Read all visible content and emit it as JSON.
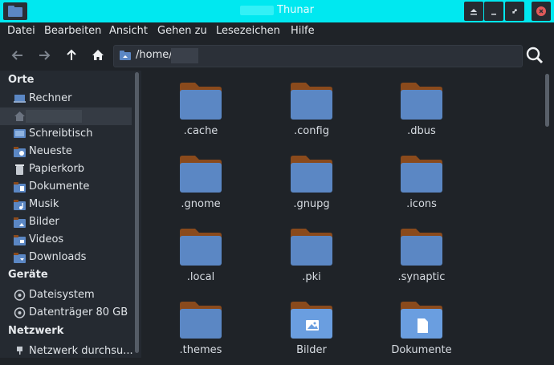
{
  "window": {
    "title": "Thunar",
    "colors": {
      "titlebar": "#00e8f0",
      "folder_body": "#5b87c4",
      "folder_tab": "#8a4a1c",
      "close_icon": "#e05a5a"
    }
  },
  "menubar": {
    "items": [
      "Datei",
      "Bearbeiten",
      "Ansicht",
      "Gehen zu",
      "Lesezeichen",
      "Hilfe"
    ]
  },
  "toolbar": {
    "back_icon": "arrow-left-icon",
    "forward_icon": "arrow-right-icon",
    "up_icon": "arrow-up-icon",
    "home_icon": "home-icon",
    "path": "/home/",
    "search_icon": "search-icon"
  },
  "sidebar": {
    "sections": [
      {
        "heading": "Orte",
        "items": [
          {
            "label": "Rechner",
            "icon": "computer-icon"
          },
          {
            "label": "",
            "icon": "home-icon",
            "selected": true
          },
          {
            "label": "Schreibtisch",
            "icon": "desktop-icon"
          },
          {
            "label": "Neueste",
            "icon": "recent-folder-icon"
          },
          {
            "label": "Papierkorb",
            "icon": "trash-icon"
          },
          {
            "label": "Dokumente",
            "icon": "documents-folder-icon"
          },
          {
            "label": "Musik",
            "icon": "music-folder-icon"
          },
          {
            "label": "Bilder",
            "icon": "pictures-folder-icon"
          },
          {
            "label": "Videos",
            "icon": "videos-folder-icon"
          },
          {
            "label": "Downloads",
            "icon": "downloads-folder-icon"
          }
        ]
      },
      {
        "heading": "Geräte",
        "items": [
          {
            "label": "Dateisystem",
            "icon": "drive-icon"
          },
          {
            "label": "Datenträger 80 GB",
            "icon": "drive-icon"
          }
        ]
      },
      {
        "heading": "Netzwerk",
        "items": [
          {
            "label": "Netzwerk durchsu...",
            "icon": "network-icon"
          }
        ]
      }
    ]
  },
  "files": [
    {
      "name": ".cache",
      "type": "folder"
    },
    {
      "name": ".config",
      "type": "folder"
    },
    {
      "name": ".dbus",
      "type": "folder"
    },
    {
      "name": ".gnome",
      "type": "folder"
    },
    {
      "name": ".gnupg",
      "type": "folder"
    },
    {
      "name": ".icons",
      "type": "folder"
    },
    {
      "name": ".local",
      "type": "folder"
    },
    {
      "name": ".pki",
      "type": "folder"
    },
    {
      "name": ".synaptic",
      "type": "folder"
    },
    {
      "name": ".themes",
      "type": "folder"
    },
    {
      "name": "Bilder",
      "type": "pictures-folder"
    },
    {
      "name": "Dokumente",
      "type": "documents-folder"
    }
  ]
}
